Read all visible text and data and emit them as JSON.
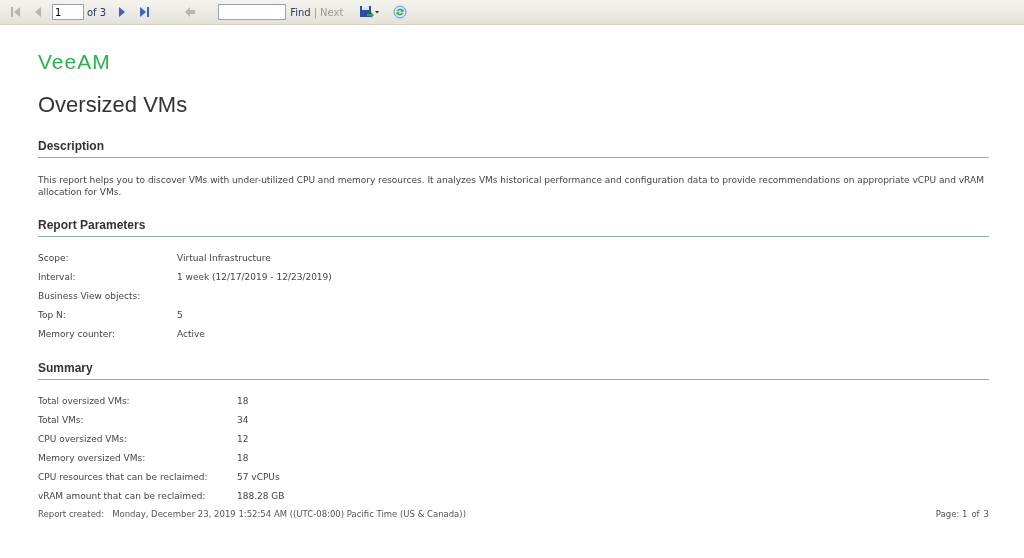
{
  "toolbar": {
    "buttons": [
      {
        "kind": "first",
        "disabled": true
      },
      {
        "kind": "prev",
        "disabled": true
      }
    ],
    "page_input": {
      "value": "1"
    },
    "page_total": "of 3",
    "nav_buttons": [
      {
        "kind": "next",
        "disabled": false
      },
      {
        "kind": "last",
        "disabled": false
      },
      {
        "kind": "back",
        "disabled": true
      }
    ],
    "find": {
      "label": "Find",
      "disabled": false
    },
    "separator": "|",
    "next": {
      "label": "Next",
      "disabled": true
    }
  },
  "logo": "VeeAM",
  "title": "Oversized VMs",
  "sections": [
    {
      "heading": "Description",
      "kind": "text",
      "text": "This report helps you to discover VMs with under-utilized CPU and memory resources. It analyzes VMs historical performance and configuration data to provide recommendations on appropriate vCPU and vRAM allocation for VMs."
    },
    {
      "heading": "Report Parameters",
      "kind": "params",
      "rows": [
        {
          "label": "Scope:",
          "value": "Virtual Infrastructure"
        },
        {
          "label": "Interval:",
          "value": "1 week (12/17/2019 - 12/23/2019)"
        },
        {
          "label": "Business View objects:"
        },
        {
          "label": "Top N:",
          "value": "5"
        },
        {
          "label": "Memory counter:",
          "value": "Active"
        }
      ]
    },
    {
      "heading": "Summary",
      "kind": "summary",
      "rows": [
        {
          "label": "Total oversized VMs:",
          "value": "18"
        },
        {
          "label": "Total VMs:",
          "value": "34"
        },
        {
          "label": "CPU oversized VMs:",
          "value": "12"
        },
        {
          "label": "Memory oversized VMs:",
          "value": "18"
        },
        {
          "label": "CPU resources that can be reclaimed:",
          "value": "57  vCPUs"
        },
        {
          "label": "vRAM amount that can be reclaimed:",
          "value": "188.28 GB"
        }
      ]
    }
  ],
  "footer": {
    "created_label": "Report created:",
    "created_value": "Monday, December 23, 2019 1:52:54 AM ((UTC-08:00) Pacific Time (US & Canada))",
    "page_label": "Page: 1",
    "page_of": "of",
    "page_total": "3"
  }
}
